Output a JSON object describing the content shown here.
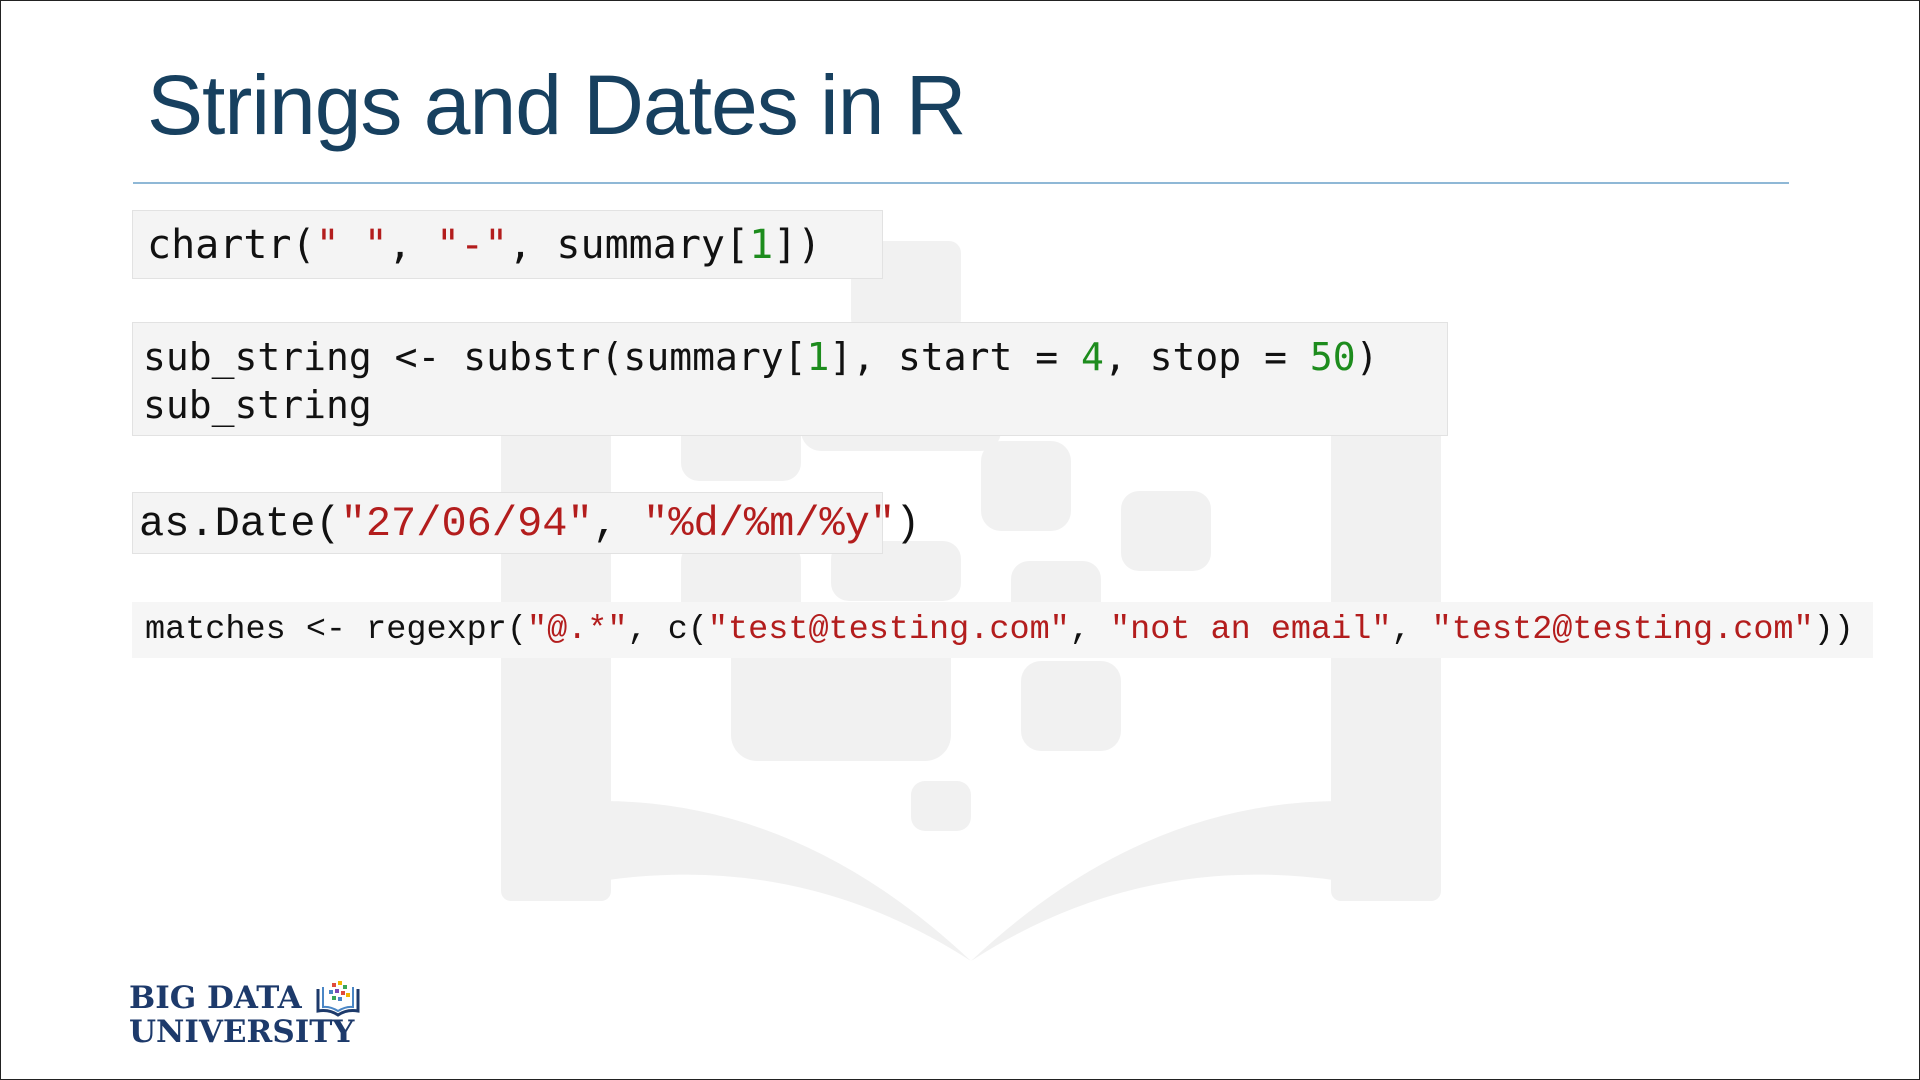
{
  "slide": {
    "title": "Strings and Dates in R"
  },
  "code_blocks": [
    {
      "lines": [
        [
          {
            "t": "chartr(",
            "k": "plain"
          },
          {
            "t": "\" \"",
            "k": "str"
          },
          {
            "t": ", ",
            "k": "plain"
          },
          {
            "t": "\"-\"",
            "k": "str"
          },
          {
            "t": ", summary[",
            "k": "plain"
          },
          {
            "t": "1",
            "k": "num"
          },
          {
            "t": "])",
            "k": "plain"
          }
        ]
      ]
    },
    {
      "lines": [
        [
          {
            "t": "sub_string <- substr(summary[",
            "k": "plain"
          },
          {
            "t": "1",
            "k": "num"
          },
          {
            "t": "], start = ",
            "k": "plain"
          },
          {
            "t": "4",
            "k": "num"
          },
          {
            "t": ", stop = ",
            "k": "plain"
          },
          {
            "t": "50",
            "k": "num"
          },
          {
            "t": ")",
            "k": "plain"
          }
        ],
        [
          {
            "t": "sub_string",
            "k": "plain"
          }
        ]
      ]
    },
    {
      "lines": [
        [
          {
            "t": "as.Date(",
            "k": "plain"
          },
          {
            "t": "\"27/06/94\"",
            "k": "str"
          },
          {
            "t": ", ",
            "k": "plain"
          },
          {
            "t": "\"%d/%m/%y\"",
            "k": "str"
          },
          {
            "t": ")",
            "k": "plain"
          }
        ]
      ]
    },
    {
      "lines": [
        [
          {
            "t": "matches <- regexpr(",
            "k": "plain"
          },
          {
            "t": "\"@.*\"",
            "k": "str"
          },
          {
            "t": ", c(",
            "k": "plain"
          },
          {
            "t": "\"test@testing.com\"",
            "k": "str"
          },
          {
            "t": ", ",
            "k": "plain"
          },
          {
            "t": "\"not an email\"",
            "k": "str"
          },
          {
            "t": ", ",
            "k": "plain"
          },
          {
            "t": "\"test2@testing.com\"",
            "k": "str"
          },
          {
            "t": "))",
            "k": "plain"
          }
        ]
      ]
    }
  ],
  "logo": {
    "line1": "BIG DATA",
    "line2": "UNIVERSITY",
    "icon": "open-book-with-dots-icon"
  },
  "colors": {
    "title": "#17405f",
    "rule": "#8fb8d6",
    "string": "#b31d1d",
    "number": "#1d8c1d",
    "logo": "#1d3a6b",
    "watermark": "#f0f0f0"
  }
}
